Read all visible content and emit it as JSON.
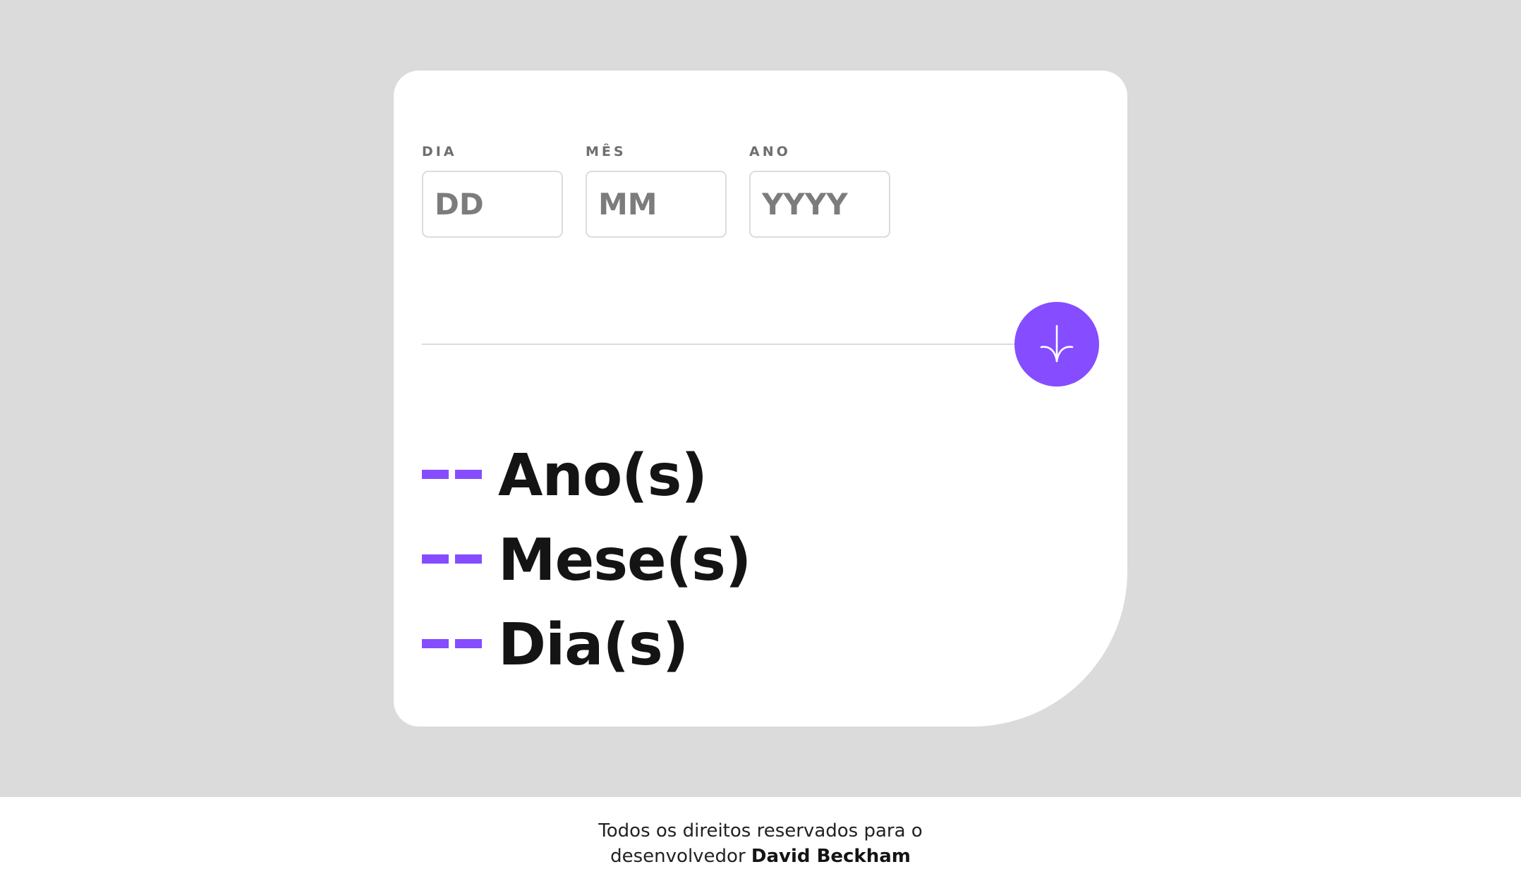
{
  "form": {
    "day": {
      "label": "DIA",
      "placeholder": "DD"
    },
    "month": {
      "label": "MÊS",
      "placeholder": "MM"
    },
    "year": {
      "label": "ANO",
      "placeholder": "YYYY"
    }
  },
  "submit_button": {
    "icon": "arrow-down-icon",
    "accent_color": "#854dff"
  },
  "results": [
    {
      "value": "--",
      "unit": "Ano(s)"
    },
    {
      "value": "--",
      "unit": "Mese(s)"
    },
    {
      "value": "--",
      "unit": "Dia(s)"
    }
  ],
  "footer": {
    "line1": "Todos os direitos reservados para o",
    "line2_prefix": "desenvolvedor",
    "developer": "David Beckham"
  }
}
